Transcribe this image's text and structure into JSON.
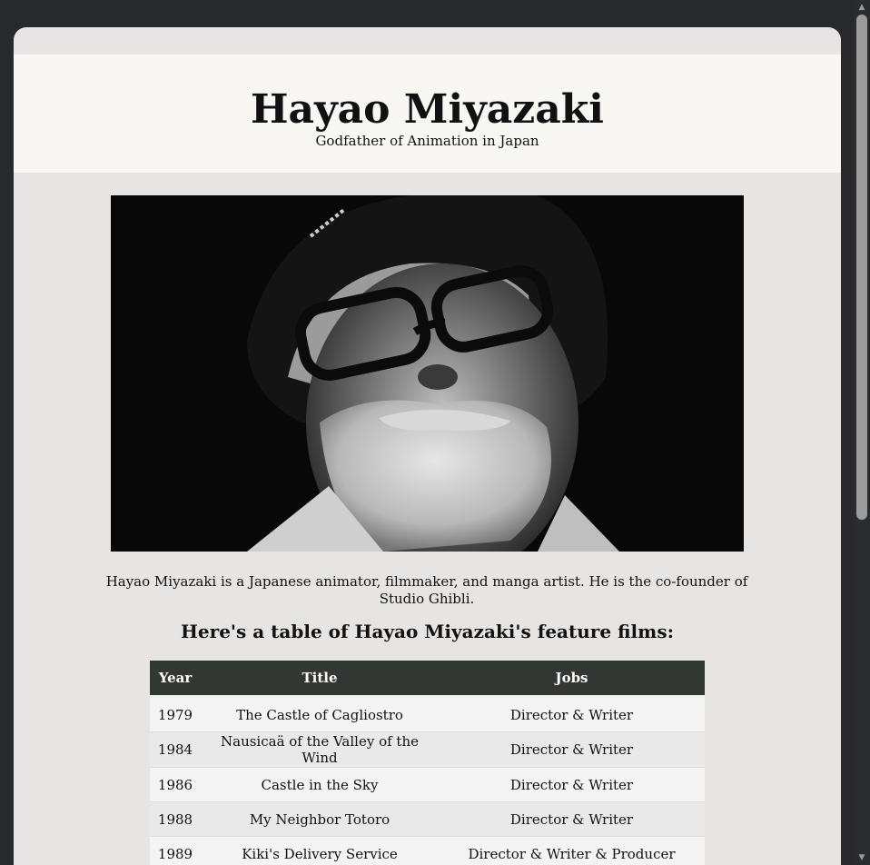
{
  "header": {
    "title": "Hayao Miyazaki",
    "subtitle": "Godfather of Animation in Japan"
  },
  "hero": {
    "image_label": "Portrait of Hayao Miyazaki"
  },
  "caption": "Hayao Miyazaki is a Japanese animator, filmmaker, and manga artist. He is the co-founder of Studio Ghibli.",
  "films": {
    "heading": "Here's a table of Hayao Miyazaki's feature films:",
    "columns": [
      "Year",
      "Title",
      "Jobs"
    ],
    "rows": [
      {
        "year": "1979",
        "title": "The Castle of Cagliostro",
        "jobs": "Director & Writer"
      },
      {
        "year": "1984",
        "title": "Nausicaä of the Valley of the Wind",
        "jobs": "Director & Writer"
      },
      {
        "year": "1986",
        "title": "Castle in the Sky",
        "jobs": "Director & Writer"
      },
      {
        "year": "1988",
        "title": "My Neighbor Totoro",
        "jobs": "Director & Writer"
      },
      {
        "year": "1989",
        "title": "Kiki's Delivery Service",
        "jobs": "Director & Writer & Producer"
      }
    ]
  },
  "colors": {
    "page_bg": "#e6e5e3",
    "header_bg": "#f8f7f3",
    "table_header_bg": "#333734",
    "frame_bg": "#28292b"
  }
}
